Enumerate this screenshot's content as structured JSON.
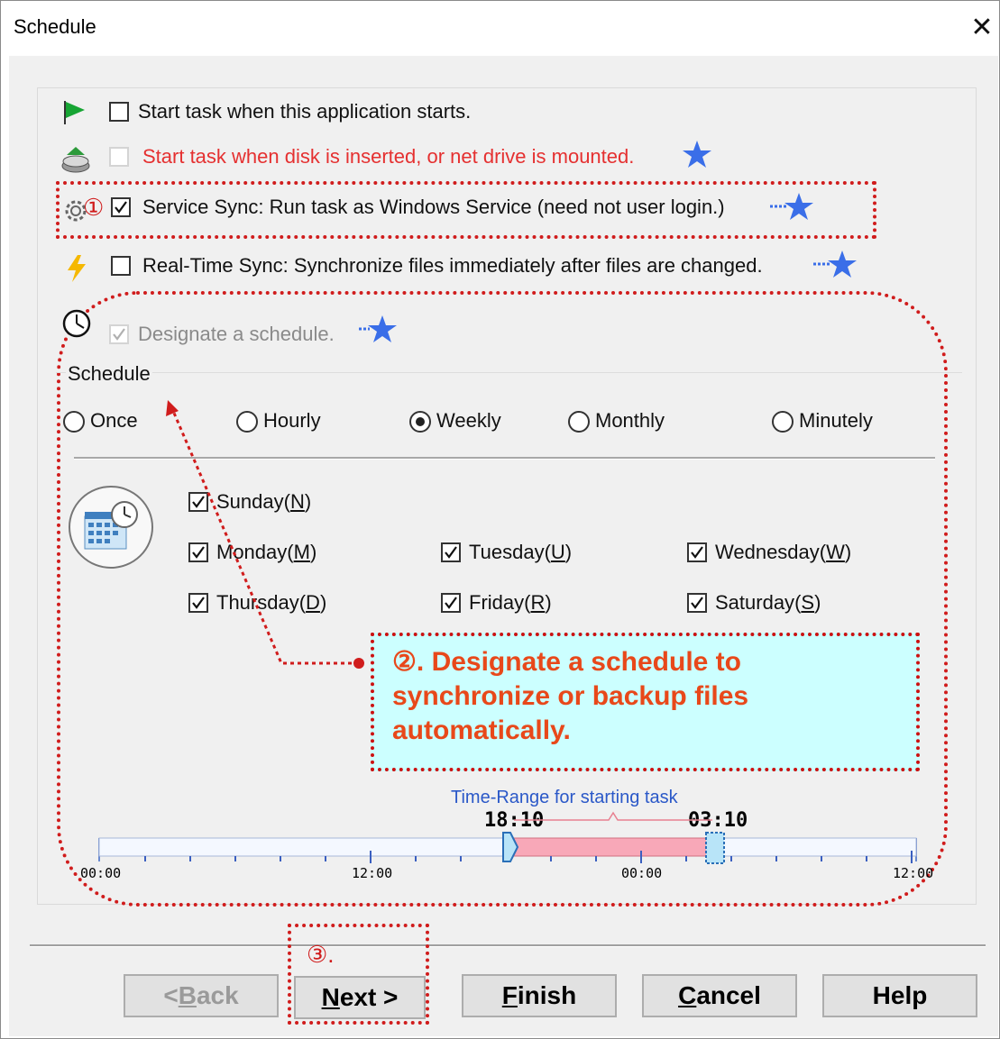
{
  "window": {
    "title": "Schedule",
    "close_label": "✕"
  },
  "options": {
    "start_on_app": "Start task when this application starts.",
    "start_on_disk": "Start task when disk is inserted, or net drive is mounted.",
    "service_sync": "Service Sync: Run task as Windows Service (need not user login.)",
    "realtime_sync": "Real-Time Sync: Synchronize files immediately after files are changed.",
    "designate": "Designate a schedule.",
    "service_marker": "①"
  },
  "schedule": {
    "group_label": "Schedule",
    "frequencies": [
      "Once",
      "Hourly",
      "Weekly",
      "Monthly",
      "Minutely"
    ],
    "selected": "Weekly",
    "days": [
      {
        "label": "Sunday",
        "key": "N",
        "checked": true
      },
      {
        "label": "Monday",
        "key": "M",
        "checked": true
      },
      {
        "label": "Tuesday",
        "key": "U",
        "checked": true
      },
      {
        "label": "Wednesday",
        "key": "W",
        "checked": true
      },
      {
        "label": "Thursday",
        "key": "D",
        "checked": true
      },
      {
        "label": "Friday",
        "key": "R",
        "checked": true
      },
      {
        "label": "Saturday",
        "key": "S",
        "checked": true
      }
    ]
  },
  "callout": {
    "text_line1": "②. Designate a schedule to",
    "text_line2": "synchronize or backup files",
    "text_line3": "automatically."
  },
  "timeline": {
    "title": "Time-Range for starting task",
    "start": "18:10",
    "end": "03:10",
    "ticks": [
      "00:00",
      "12:00",
      "00:00",
      "12:00"
    ]
  },
  "buttons": {
    "back": "<Back",
    "next": "Next >",
    "finish": "Finish",
    "cancel": "Cancel",
    "help": "Help",
    "step_marker": "③."
  },
  "colors": {
    "annotation_red": "#d01c1c",
    "callout_bg": "#ccffff",
    "callout_text": "#e8481a",
    "range_fill": "#f8a8b8",
    "range_label": "#2a58c8"
  }
}
